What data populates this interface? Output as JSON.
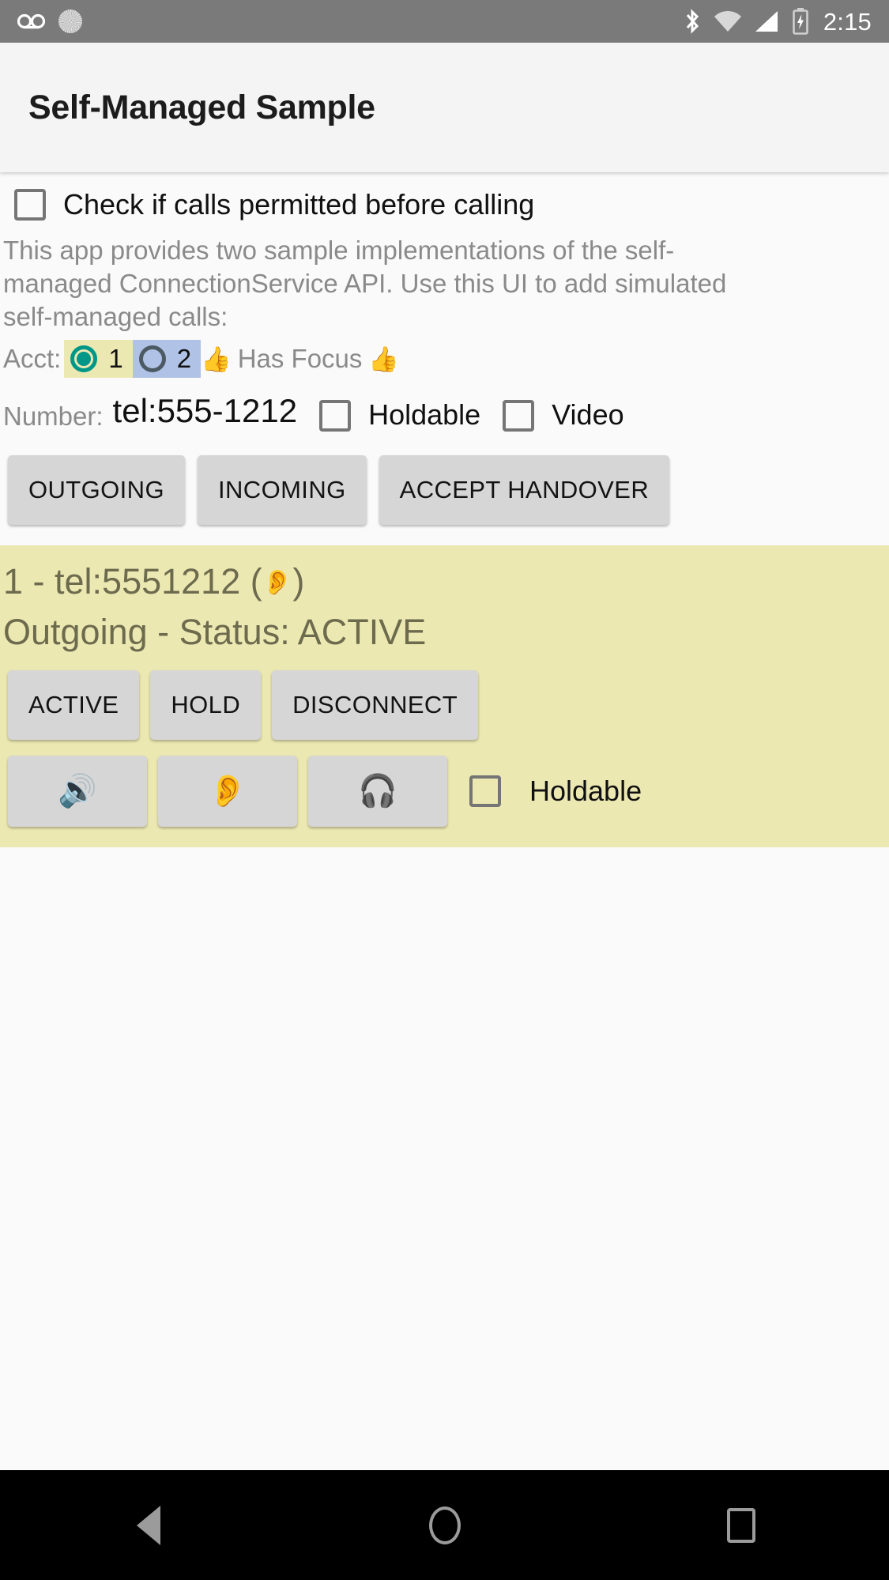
{
  "status_bar": {
    "time": "2:15",
    "left_icons": [
      "voicemail-icon",
      "sync-spinner-icon"
    ],
    "right_icons": [
      "bluetooth-icon",
      "wifi-icon",
      "signal-icon",
      "battery-charging-icon"
    ]
  },
  "action_bar": {
    "title": "Self-Managed Sample"
  },
  "permit": {
    "label": "Check if calls permitted before calling",
    "checked": false
  },
  "description": "This app provides two sample implementations of the self-managed ConnectionService API.  Use this UI to add simulated self-managed calls:",
  "account": {
    "label": "Acct:",
    "options": [
      {
        "num": "1",
        "selected": true
      },
      {
        "num": "2",
        "selected": false
      }
    ],
    "focus_text": "Has Focus",
    "focus_emoji_left": "👍",
    "focus_emoji_right": "👍",
    "selected_bg": "#ece8b2",
    "unselected_bg": "#b0c3e6",
    "accent": "#009688"
  },
  "number": {
    "label": "Number:",
    "value": "tel:555-1212",
    "placeholder": "Number",
    "holdable_label": "Holdable",
    "holdable_checked": false,
    "video_label": "Video",
    "video_checked": false
  },
  "actions": {
    "outgoing": "OUTGOING",
    "incoming": "INCOMING",
    "accept_handover": "ACCEPT HANDOVER"
  },
  "call": {
    "title_prefix": "1 - tel:5551212 ( ",
    "title_emoji": "👂",
    "title_suffix": " )",
    "status": "Outgoing - Status: ACTIVE",
    "background": "#ece8b2",
    "text_color": "#6d6b4e",
    "controls": {
      "active": "ACTIVE",
      "hold": "HOLD",
      "disconnect": "DISCONNECT"
    },
    "audio_routes": [
      {
        "name": "speaker",
        "emoji": "🔊"
      },
      {
        "name": "earpiece",
        "emoji": "👂"
      },
      {
        "name": "headset",
        "emoji": "🎧"
      }
    ],
    "holdable_label": "Holdable",
    "holdable_checked": false
  },
  "nav_bar": {
    "back": "back-icon",
    "home": "home-icon",
    "recents": "recents-icon"
  }
}
